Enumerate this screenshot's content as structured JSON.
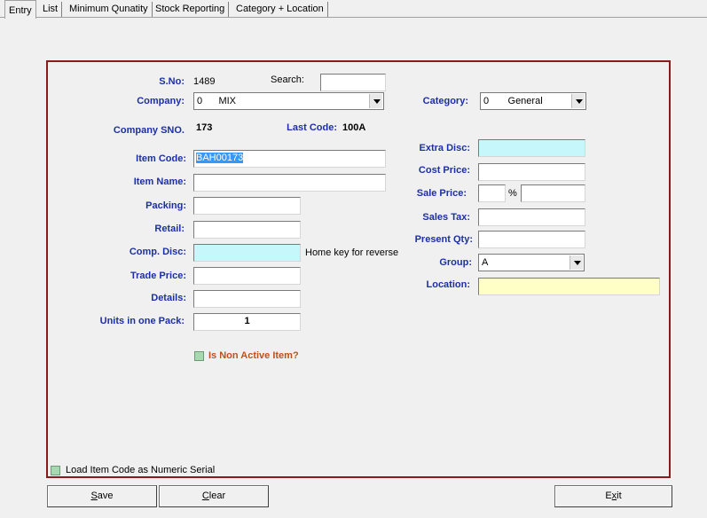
{
  "tabs": [
    "Entry",
    "List",
    "Minimum Qunatity",
    "Stock Reporting",
    "Category + Location"
  ],
  "form": {
    "sno_label": "S.No:",
    "sno_value": "1489",
    "search_label": "Search:",
    "search_value": "",
    "company_label": "Company:",
    "company_value": "0      MIX",
    "category_label": "Category:",
    "category_value": "0       General",
    "company_sno_label": "Company SNO.",
    "company_sno_value": "173",
    "last_code_label": "Last Code:",
    "last_code_value": "100A",
    "extra_disc_label": "Extra Disc:",
    "extra_disc_value": "",
    "item_code_label": "Item Code:",
    "item_code_value": "BAH00173",
    "cost_price_label": "Cost Price:",
    "cost_price_value": "",
    "item_name_label": "Item Name:",
    "item_name_value": "",
    "sale_price_label": "Sale Price:",
    "sale_price_pct_value": "",
    "pct_sign": "%",
    "sale_price_value": "",
    "packing_label": "Packing:",
    "packing_value": "",
    "sales_tax_label": "Sales Tax:",
    "sales_tax_value": "",
    "retail_label": "Retail:",
    "retail_value": "",
    "present_qty_label": "Present Qty:",
    "present_qty_value": "",
    "comp_disc_label": "Comp. Disc:",
    "comp_disc_value": "",
    "comp_disc_hint": "Home key for reverse",
    "group_label": "Group:",
    "group_value": "A",
    "trade_price_label": "Trade Price:",
    "trade_price_value": "",
    "location_label": "Location:",
    "location_value": "",
    "details_label": "Details:",
    "details_value": "",
    "units_label": "Units in one Pack:",
    "units_value": "1",
    "non_active_label": "Is Non Active Item?",
    "numeric_serial_label": "Load Item Code as Numeric Serial"
  },
  "buttons": {
    "save_hot": "S",
    "save_rest": "ave",
    "clear_hot": "C",
    "clear_rest": "lear",
    "exit_first": "E",
    "exit_hot": "x",
    "exit_rest": "it"
  },
  "colors": {
    "frame": "#8b1a1a",
    "label": "#1c2fa6",
    "cyan_field": "#c6f7fb",
    "yellow_field": "#ffffc6",
    "non_active_label": "#c0501a"
  }
}
